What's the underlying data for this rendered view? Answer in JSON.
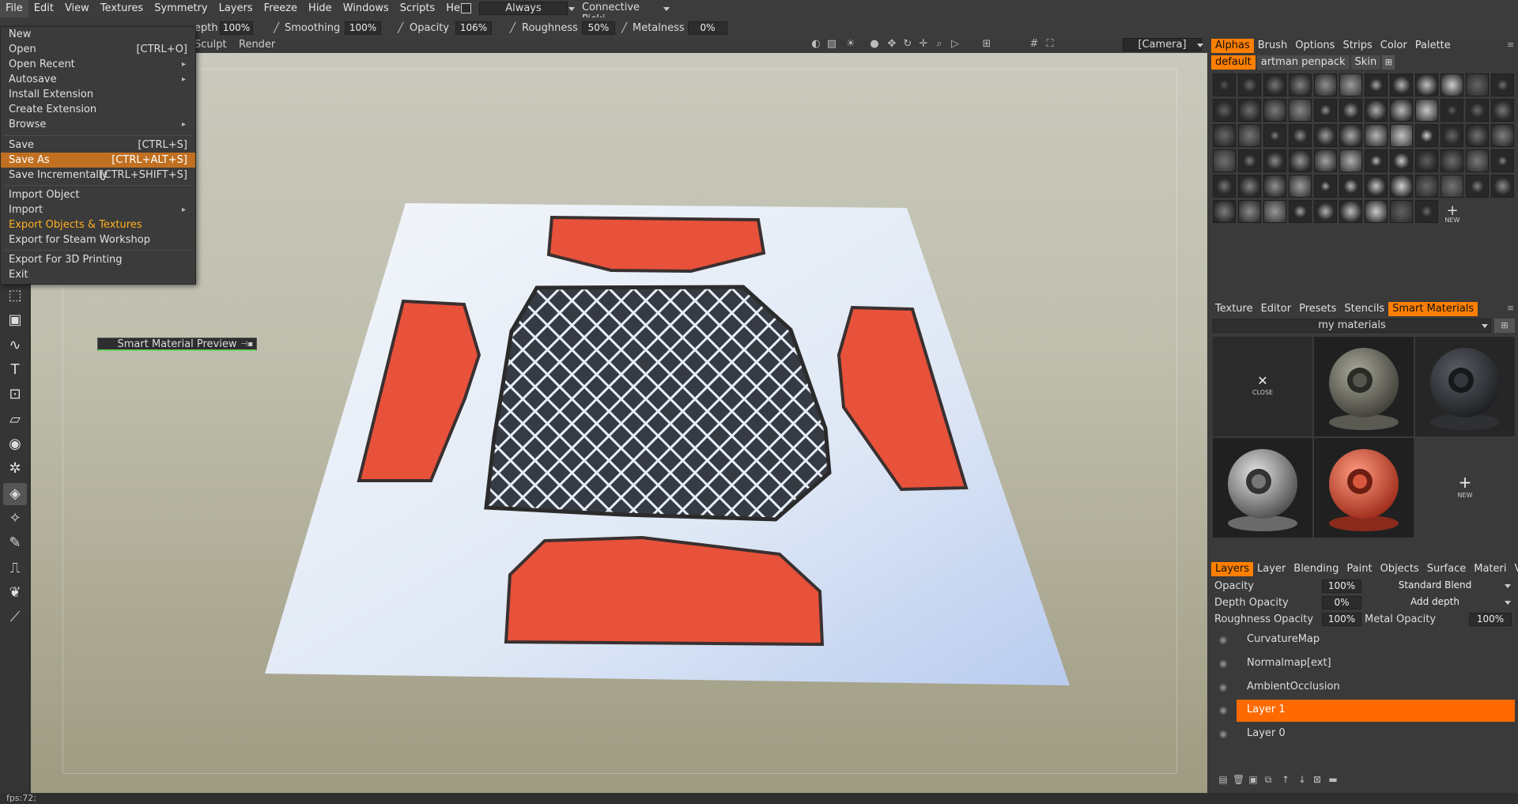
{
  "menubar": {
    "items": [
      "File",
      "Edit",
      "View",
      "Textures",
      "Symmetry",
      "Layers",
      "Freeze",
      "Hide",
      "Windows",
      "Scripts",
      "Help"
    ],
    "always_label": "Always",
    "picking_label": "Connective Picki"
  },
  "toolbar": {
    "depth_label": "epth",
    "depth_value": "100%",
    "smoothing_label": "Smoothing",
    "smoothing_value": "100%",
    "opacity_label": "Opacity",
    "opacity_value": "106%",
    "roughness_label": "Roughness",
    "roughness_value": "50%",
    "metalness_label": "Metalness",
    "metalness_value": "0%",
    "camera_label": "[Camera]"
  },
  "modebar": {
    "sculpt": "Sculpt",
    "render": "Render"
  },
  "file_menu": {
    "items": [
      {
        "label": "New",
        "shortcut": ""
      },
      {
        "label": "Open",
        "shortcut": "[CTRL+O]"
      },
      {
        "label": "Open Recent",
        "shortcut": ""
      },
      {
        "label": "Autosave",
        "shortcut": ""
      },
      {
        "label": "Install Extension",
        "shortcut": ""
      },
      {
        "label": "Create Extension",
        "shortcut": ""
      },
      {
        "label": "Browse",
        "shortcut": ""
      },
      {
        "label": "Save",
        "shortcut": "[CTRL+S]"
      },
      {
        "label": "Save As",
        "shortcut": "[CTRL+ALT+S]"
      },
      {
        "label": "Save Incrementally",
        "shortcut": "[CTRL+SHIFT+S]"
      },
      {
        "label": "Import Object",
        "shortcut": ""
      },
      {
        "label": "Import",
        "shortcut": ""
      },
      {
        "label": "Export Objects & Textures",
        "shortcut": ""
      },
      {
        "label": "Export for Steam Workshop",
        "shortcut": ""
      },
      {
        "label": "Export For 3D Printing",
        "shortcut": ""
      },
      {
        "label": "Exit",
        "shortcut": ""
      }
    ],
    "highlighted": "Save As"
  },
  "smart_material_preview": "Smart Material Preview",
  "alphas_panel": {
    "tabs": [
      "Alphas",
      "Brush",
      "Options",
      "Strips",
      "Color",
      "Palette"
    ],
    "active_tab": "Alphas",
    "subtabs": [
      "default",
      "artman penpack",
      "Skin"
    ],
    "active_subtab": "default",
    "new_label": "NEW"
  },
  "materials_panel": {
    "tabs": [
      "Texture",
      "Editor",
      "Presets",
      "Stencils",
      "Smart Materials"
    ],
    "active_tab": "Smart Materials",
    "folder": "my materials",
    "close_label": "CLOSE",
    "new_label": "NEW"
  },
  "layers_panel": {
    "tabs": [
      "Layers",
      "Layer",
      "Blending",
      "Paint",
      "Objects",
      "Surface",
      "Materi",
      "VoxTree"
    ],
    "active_tab": "Layers",
    "opacity_label": "Opacity",
    "opacity_value": "100%",
    "blend_mode": "Standard Blend",
    "depth_opacity_label": "Depth Opacity",
    "depth_opacity_value": "0%",
    "depth_mode": "Add depth",
    "roughness_opacity_label": "Roughness Opacity",
    "roughness_opacity_value": "100%",
    "metal_opacity_label": "Metal Opacity",
    "metal_opacity_value": "100%",
    "layers": [
      "CurvatureMap",
      "Normalmap[ext]",
      "AmbientOcclusion",
      "Layer 1",
      "Layer 0"
    ],
    "selected_layer": "Layer 1"
  },
  "status": {
    "fps": "fps:72;"
  },
  "colors": {
    "accent": "#ff7f00",
    "menu_highlight": "#c07020",
    "paint_red": "#e8513a"
  }
}
